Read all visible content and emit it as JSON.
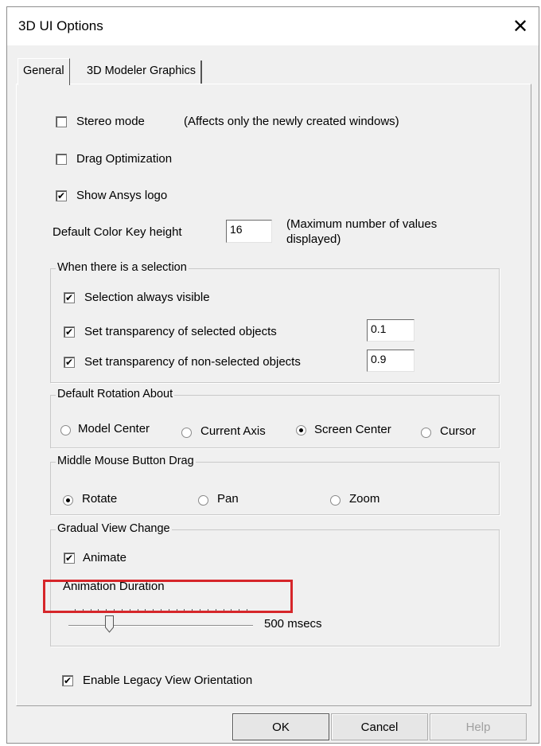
{
  "window": {
    "title": "3D UI Options",
    "close_icon": "✕"
  },
  "tabs": [
    {
      "label": "General"
    },
    {
      "label": "3D Modeler Graphics"
    }
  ],
  "general": {
    "stereo_mode": {
      "label": "Stereo mode",
      "checked": false
    },
    "stereo_note": "(Affects only the newly created windows)",
    "drag_optimization": {
      "label": "Drag Optimization",
      "checked": false
    },
    "show_logo": {
      "label": "Show Ansys logo",
      "checked": true
    },
    "color_key": {
      "label": "Default Color Key height",
      "value": "16",
      "note_line1": "(Maximum number of values",
      "note_line2": "displayed)"
    }
  },
  "selection_group": {
    "title": "When there is a selection",
    "always_visible": {
      "label": "Selection always visible",
      "checked": true
    },
    "selected_transparency": {
      "label": "Set transparency of selected objects",
      "checked": true,
      "value": "0.1"
    },
    "nonselected_transparency": {
      "label": "Set transparency of non-selected objects",
      "checked": true,
      "value": "0.9"
    }
  },
  "rotation_group": {
    "title": "Default Rotation About",
    "options": [
      "Model Center",
      "Current Axis",
      "Screen Center",
      "Cursor"
    ],
    "selected": "Screen Center"
  },
  "mouse_group": {
    "title": "Middle Mouse Button Drag",
    "options": [
      "Rotate",
      "Pan",
      "Zoom"
    ],
    "selected": "Rotate"
  },
  "view_change_group": {
    "title": "Gradual View Change",
    "animate": {
      "label": "Animate",
      "checked": true
    },
    "duration_label": "Animation Duration",
    "duration_value": "500 msecs",
    "slider_fraction": 0.2
  },
  "legacy": {
    "label": "Enable Legacy View Orientation",
    "checked": true
  },
  "buttons": {
    "ok": "OK",
    "cancel": "Cancel",
    "help": "Help"
  },
  "check_mark": "✔",
  "colors": {
    "highlight": "#d6262a",
    "dialog_bg": "#f0f0f0"
  }
}
